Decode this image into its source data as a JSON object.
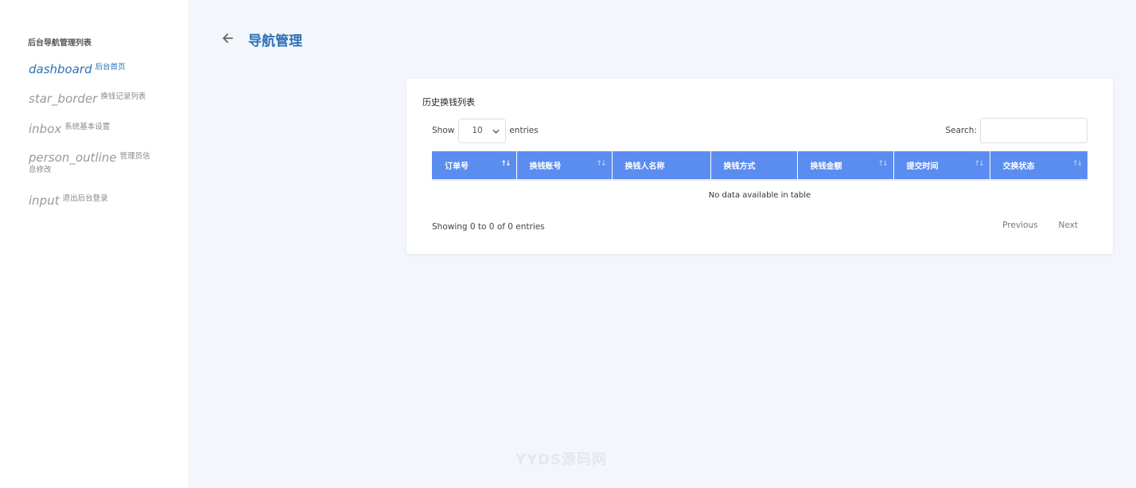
{
  "sidebar": {
    "heading": "后台导航管理列表",
    "items": [
      {
        "icon": "dashboard",
        "label": "后台首页"
      },
      {
        "icon": "star_border",
        "label": "换钱记录列表"
      },
      {
        "icon": "inbox",
        "label": "系统基本设置"
      },
      {
        "icon": "person_outline",
        "label": "管理员信息修改"
      },
      {
        "icon": "input",
        "label": "退出后台登录"
      }
    ]
  },
  "header": {
    "title": "导航管理"
  },
  "card": {
    "title": "历史换钱列表",
    "show_label": "Show",
    "entries_value": "10",
    "entries_label": "entries",
    "search_label": "Search:",
    "columns": [
      "订单号",
      "换钱账号",
      "换钱人名称",
      "换钱方式",
      "换钱金额",
      "提交时间",
      "交换状态"
    ],
    "empty_text": "No data available in table",
    "info_text": "Showing 0 to 0 of 0 entries",
    "pager": {
      "previous": "Previous",
      "next": "Next"
    }
  },
  "watermark": "YYDS源码网",
  "colors": {
    "accent": "#2b72b8",
    "header_bg": "#5b8cf0",
    "page_bg": "#f3f6fa"
  }
}
